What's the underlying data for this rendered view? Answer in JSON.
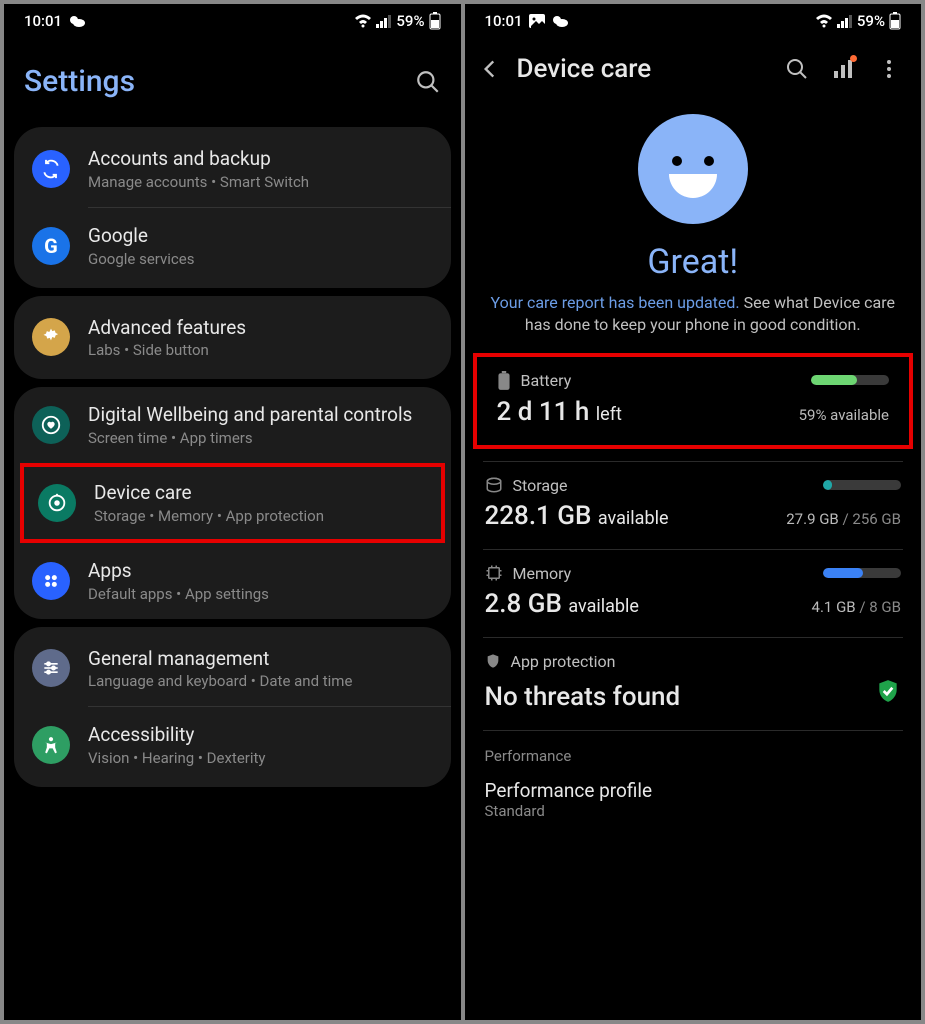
{
  "status": {
    "time": "10:01",
    "battery_percent": "59%"
  },
  "left": {
    "title": "Settings",
    "groups": [
      {
        "items": [
          {
            "title": "Accounts and backup",
            "sub": "Manage accounts  •  Smart Switch"
          },
          {
            "title": "Google",
            "sub": "Google services"
          }
        ]
      },
      {
        "items": [
          {
            "title": "Advanced features",
            "sub": "Labs  •  Side button"
          }
        ]
      },
      {
        "items": [
          {
            "title": "Digital Wellbeing and parental controls",
            "sub": "Screen time  •  App timers"
          },
          {
            "title": "Device care",
            "sub": "Storage  •  Memory  •  App protection",
            "highlight": true
          },
          {
            "title": "Apps",
            "sub": "Default apps  •  App settings"
          }
        ]
      },
      {
        "items": [
          {
            "title": "General management",
            "sub": "Language and keyboard  •  Date and time"
          },
          {
            "title": "Accessibility",
            "sub": "Vision  •  Hearing  •  Dexterity"
          }
        ]
      }
    ]
  },
  "right": {
    "title": "Device care",
    "hero": {
      "headline": "Great!",
      "msg_accent": "Your care report has been updated.",
      "msg_rest": " See what Device care has done to keep your phone in good condition."
    },
    "battery": {
      "label": "Battery",
      "main": "2 d 11 h",
      "suffix": "left",
      "side": "59% available",
      "fill_pct": 59,
      "fill_color": "#6dd572"
    },
    "storage": {
      "label": "Storage",
      "main": "228.1 GB",
      "suffix": "available",
      "side_used": "27.9 GB",
      "side_total": " / 256 GB",
      "fill_pct": 11,
      "fill_color": "#1fa7a7"
    },
    "memory": {
      "label": "Memory",
      "main": "2.8 GB",
      "suffix": "available",
      "side_used": "4.1 GB",
      "side_total": " / 8 GB",
      "fill_pct": 51,
      "fill_color": "#3b82f6"
    },
    "app_protection": {
      "label": "App protection",
      "main": "No threats found"
    },
    "performance": {
      "header": "Performance",
      "title": "Performance profile",
      "sub": "Standard"
    }
  }
}
